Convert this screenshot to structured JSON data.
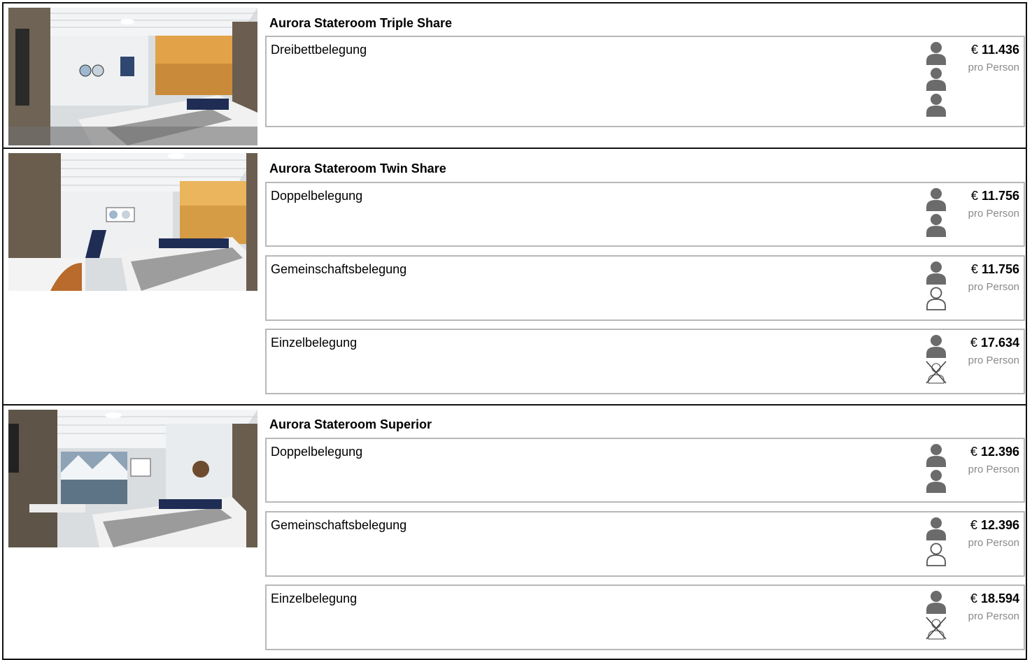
{
  "cabins": [
    {
      "title": "Aurora Stateroom Triple Share",
      "options": [
        {
          "label": "Dreibettbelegung",
          "currency": "€",
          "price": "11.436",
          "per": "pro Person",
          "occupancy_icons": [
            "person-filled-icon",
            "person-filled-icon",
            "person-filled-icon"
          ]
        }
      ]
    },
    {
      "title": "Aurora Stateroom Twin Share",
      "options": [
        {
          "label": "Doppelbelegung",
          "currency": "€",
          "price": "11.756",
          "per": "pro Person",
          "occupancy_icons": [
            "person-filled-icon",
            "person-filled-icon"
          ]
        },
        {
          "label": "Gemeinschaftsbelegung",
          "currency": "€",
          "price": "11.756",
          "per": "pro Person",
          "occupancy_icons": [
            "person-filled-icon",
            "person-outline-icon"
          ]
        },
        {
          "label": "Einzelbelegung",
          "currency": "€",
          "price": "17.634",
          "per": "pro Person",
          "occupancy_icons": [
            "person-filled-icon",
            "person-crossed-icon"
          ]
        }
      ]
    },
    {
      "title": "Aurora Stateroom Superior",
      "options": [
        {
          "label": "Doppelbelegung",
          "currency": "€",
          "price": "12.396",
          "per": "pro Person",
          "occupancy_icons": [
            "person-filled-icon",
            "person-filled-icon"
          ]
        },
        {
          "label": "Gemeinschaftsbelegung",
          "currency": "€",
          "price": "12.396",
          "per": "pro Person",
          "occupancy_icons": [
            "person-filled-icon",
            "person-outline-icon"
          ]
        },
        {
          "label": "Einzelbelegung",
          "currency": "€",
          "price": "18.594",
          "per": "pro Person",
          "occupancy_icons": [
            "person-filled-icon",
            "person-crossed-icon"
          ]
        }
      ]
    }
  ],
  "colors": {
    "icon_gray": "#6b6b6b",
    "border_gray": "#b8b8b8",
    "price_sub_gray": "#8a8a8a"
  }
}
